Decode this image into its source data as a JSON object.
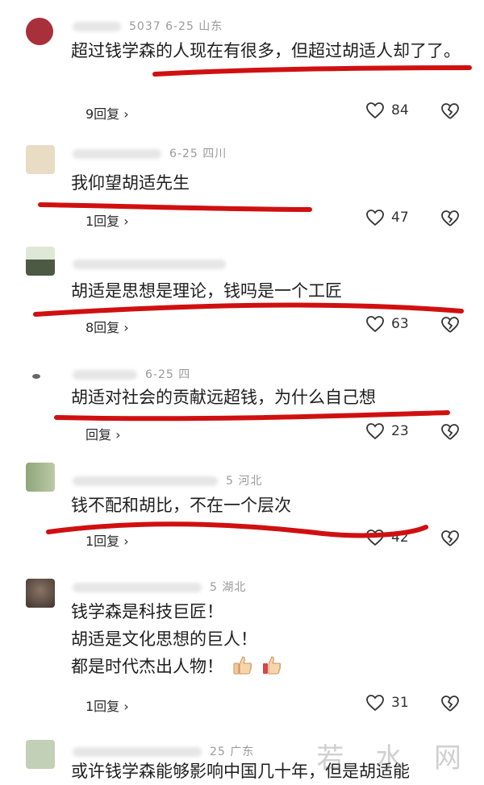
{
  "comments": [
    {
      "meta_visible": "5037  6-25  山东",
      "text": "超过钱学森的人现在有很多，但超过胡适人却了了。",
      "replies": "9回复 ›",
      "likes": "84",
      "avatar_color": "#a8303a"
    },
    {
      "meta_visible": "6-25  四川",
      "text": "我仰望胡适先生",
      "replies": "1回复 ›",
      "likes": "47",
      "avatar_color": "#e9dcc4"
    },
    {
      "meta_visible": "",
      "text": "胡适是思想是理论，钱吗是一个工匠",
      "replies": "8回复 ›",
      "likes": "63",
      "avatar_color": "#5d6b52"
    },
    {
      "meta_visible": "6-25  四",
      "text": "胡适对社会的贡献远超钱，为什么自己想",
      "replies": "回复 ›",
      "likes": "23",
      "avatar_color": "#ffffff"
    },
    {
      "meta_visible": "5  河北",
      "text": "钱不配和胡比，不在一个层次",
      "replies": "1回复 ›",
      "likes": "42",
      "avatar_color": "#8ea67a"
    },
    {
      "meta_visible": "5  湖北",
      "text_lines": [
        "钱学森是科技巨匠！",
        "胡适是文化思想的巨人！",
        "都是时代杰出人物！"
      ],
      "replies": "1回复 ›",
      "likes": "31",
      "avatar_color": "#6f5b4e"
    },
    {
      "meta_visible": "25  广东",
      "text": "或许钱学森能够影响中国几十年，但是胡适能",
      "avatar_color": "#c3d0b8"
    }
  ],
  "watermark": "若 水 网",
  "colors": {
    "underline": "#d01010",
    "meta": "#9a9a9a"
  }
}
